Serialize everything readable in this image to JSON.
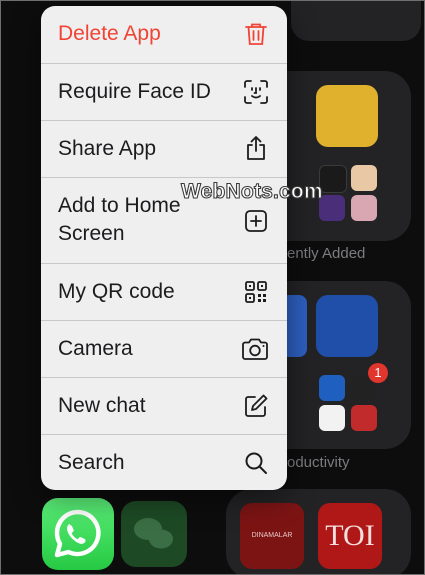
{
  "menu": {
    "items": [
      {
        "label": "Delete App",
        "icon": "trash-icon",
        "destructive": true
      },
      {
        "label": "Require Face ID",
        "icon": "face-id-icon"
      },
      {
        "label": "Share App",
        "icon": "share-icon"
      },
      {
        "label": "Add to Home Screen",
        "icon": "add-square-icon"
      },
      {
        "label": "My QR code",
        "icon": "qr-code-icon"
      },
      {
        "label": "Camera",
        "icon": "camera-icon"
      },
      {
        "label": "New chat",
        "icon": "compose-icon"
      },
      {
        "label": "Search",
        "icon": "search-icon"
      }
    ]
  },
  "background": {
    "folder_labels": [
      "ently Added",
      "oductivity"
    ],
    "tiles": [
      "DINAMALAR",
      "TOI"
    ],
    "badge": "1"
  },
  "watermark": "WebNots.com",
  "colors": {
    "destructive": "#f04435",
    "menu_bg": "#efeff0",
    "whatsapp": "#2fd24f"
  }
}
